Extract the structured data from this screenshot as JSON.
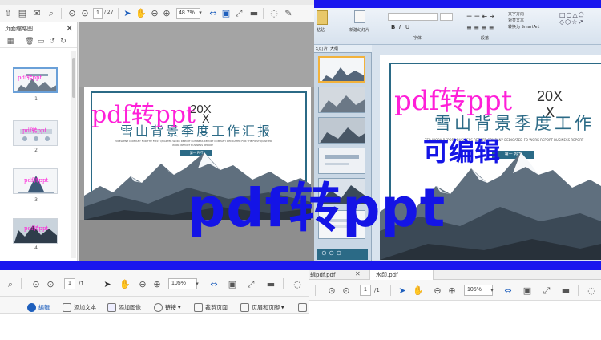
{
  "left_app": {
    "page_field": "1",
    "page_total": "/ 27",
    "zoom": "48.7%",
    "thumbnail_panel_title": "页面缩略图",
    "thumbnails": [
      {
        "number": "1"
      },
      {
        "number": "2"
      },
      {
        "number": "3"
      },
      {
        "number": "4"
      }
    ]
  },
  "slide": {
    "overlay_text": "pdf转ppt",
    "year_mark": "20X",
    "cross": "X",
    "title": "雪山背景季度工作汇报",
    "subtitle_left": "EXCELLENT COMPANY FOR THE FIRST QUARTER WORK REPORT BUSINESS REPORT COMPANY DEDICATED FOR THE FIRST QUARTER",
    "subtitle_right": "WORK REPORT BUSINESS REPORT",
    "subtitle_right2": "WORK REPORT BUSINESS REPORT",
    "button_label": "第一 PPT"
  },
  "right_app": {
    "ribbon_tabs": [
      "粘贴",
      "新建幻灯片",
      "字体",
      "段落"
    ],
    "panel_tabs": [
      "幻灯片",
      "大纲"
    ],
    "ribbon_extra": [
      "文字方向",
      "对齐文本",
      "转换为 SmartArt"
    ],
    "slide_overlay": "pdf转ppt",
    "slide_year": "20X",
    "slide_cross": "X",
    "slide_title": "雪山背景季度工作",
    "slide_subtitle": "TER WORK REPORT BUSINESS REPORT COMPANY DEDICATED FO WORK REPORT BUSINESS REPORT",
    "slide_button": "第一 PPT",
    "editable_badge": "可编辑"
  },
  "banner": {
    "text": "pdf转ppt"
  },
  "bottom_left": {
    "page_field": "1",
    "page_total": "/1",
    "zoom": "105%",
    "edit_toolbar": [
      "编辑",
      "添加文本",
      "添加图像",
      "链接",
      "裁剪页面",
      "页眉和页脚"
    ]
  },
  "bottom_right": {
    "tabs": [
      "辑pdf.pdf",
      "水印.pdf"
    ],
    "page_field": "1",
    "page_total": "/1",
    "zoom": "105%"
  },
  "colors": {
    "accent_blue": "#1a17ee",
    "overlay_magenta": "#ff1fd8",
    "overlay_blue": "#1414e6",
    "slide_frame": "#2b6a86"
  }
}
